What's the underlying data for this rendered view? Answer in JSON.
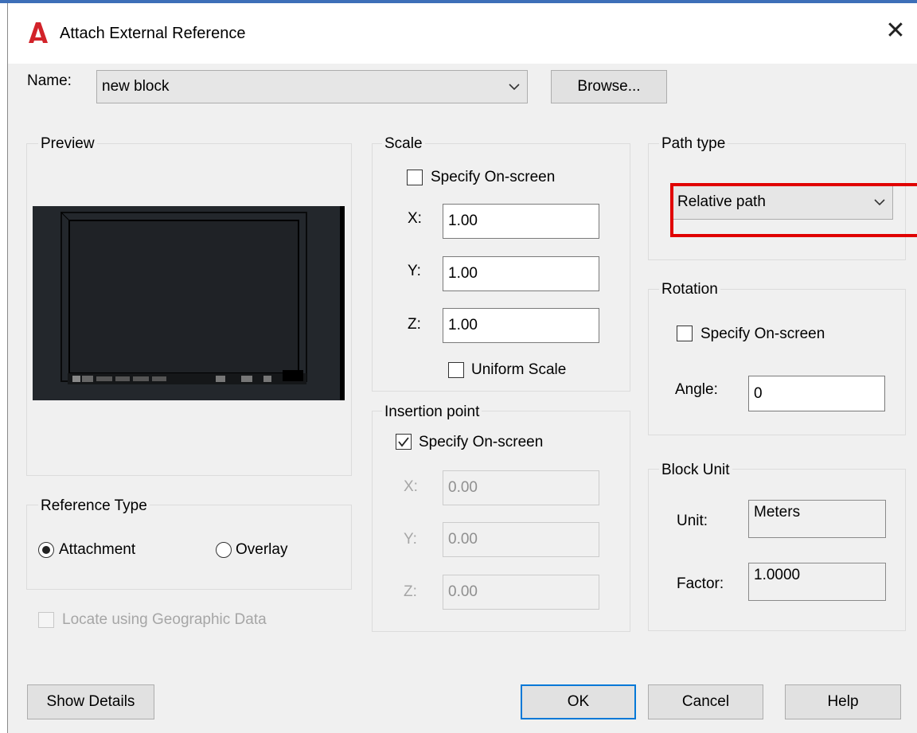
{
  "window": {
    "title": "Attach External Reference",
    "close_glyph": "✕",
    "icon": "autocad-logo-icon",
    "accent": "#0078d7",
    "brand_red": "#d2232a"
  },
  "name_row": {
    "label": "Name:",
    "value": "new block",
    "browse_label": "Browse..."
  },
  "preview": {
    "label": "Preview"
  },
  "scale": {
    "label": "Scale",
    "specify_label": "Specify On-screen",
    "specify_checked": false,
    "x_label": "X:",
    "x_value": "1.00",
    "y_label": "Y:",
    "y_value": "1.00",
    "z_label": "Z:",
    "z_value": "1.00",
    "uniform_label": "Uniform Scale",
    "uniform_checked": false
  },
  "insertion": {
    "label": "Insertion point",
    "specify_label": "Specify On-screen",
    "specify_checked": true,
    "x_label": "X:",
    "x_value": "0.00",
    "y_label": "Y:",
    "y_value": "0.00",
    "z_label": "Z:",
    "z_value": "0.00"
  },
  "path_type": {
    "label": "Path type",
    "value": "Relative path",
    "highlight_color": "#e00000"
  },
  "rotation": {
    "label": "Rotation",
    "specify_label": "Specify On-screen",
    "specify_checked": false,
    "angle_label": "Angle:",
    "angle_value": "0"
  },
  "block_unit": {
    "label": "Block Unit",
    "unit_label": "Unit:",
    "unit_value": "Meters",
    "factor_label": "Factor:",
    "factor_value": "1.0000"
  },
  "reference_type": {
    "label": "Reference Type",
    "options": [
      "Attachment",
      "Overlay"
    ],
    "selected": "Attachment"
  },
  "geo": {
    "label": "Locate using Geographic Data",
    "checked": false,
    "enabled": false
  },
  "buttons": {
    "show_details": "Show Details",
    "ok": "OK",
    "cancel": "Cancel",
    "help": "Help"
  }
}
